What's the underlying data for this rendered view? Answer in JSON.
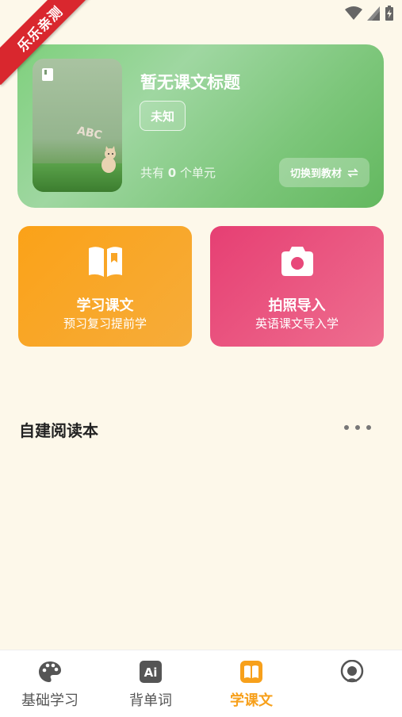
{
  "ribbon": {
    "text": "乐乐亲测"
  },
  "hero": {
    "title": "暂无课文标题",
    "badge": "未知",
    "units_prefix": "共有",
    "units_count": "0",
    "units_suffix": "个单元",
    "switch_label": "切换到教材",
    "cover_letters": "ABC"
  },
  "cards": {
    "learn": {
      "title": "学习课文",
      "subtitle": "预习复习提前学",
      "icon": "open-book-icon"
    },
    "photo": {
      "title": "拍照导入",
      "subtitle": "英语课文导入学",
      "icon": "camera-icon"
    }
  },
  "section": {
    "title": "自建阅读本"
  },
  "tabs": [
    {
      "label": "基础学习",
      "icon": "palette-icon"
    },
    {
      "label": "背单词",
      "icon": "ai-icon"
    },
    {
      "label": "学课文",
      "icon": "book-icon"
    },
    {
      "label": "",
      "icon": "profile-icon"
    }
  ],
  "colors": {
    "accent": "#f7a01b",
    "hero_green": "#7cc67a",
    "card_orange": "#fba218",
    "card_pink": "#e63f73",
    "ribbon_red": "#d9272e",
    "background": "#fdf8ea"
  }
}
